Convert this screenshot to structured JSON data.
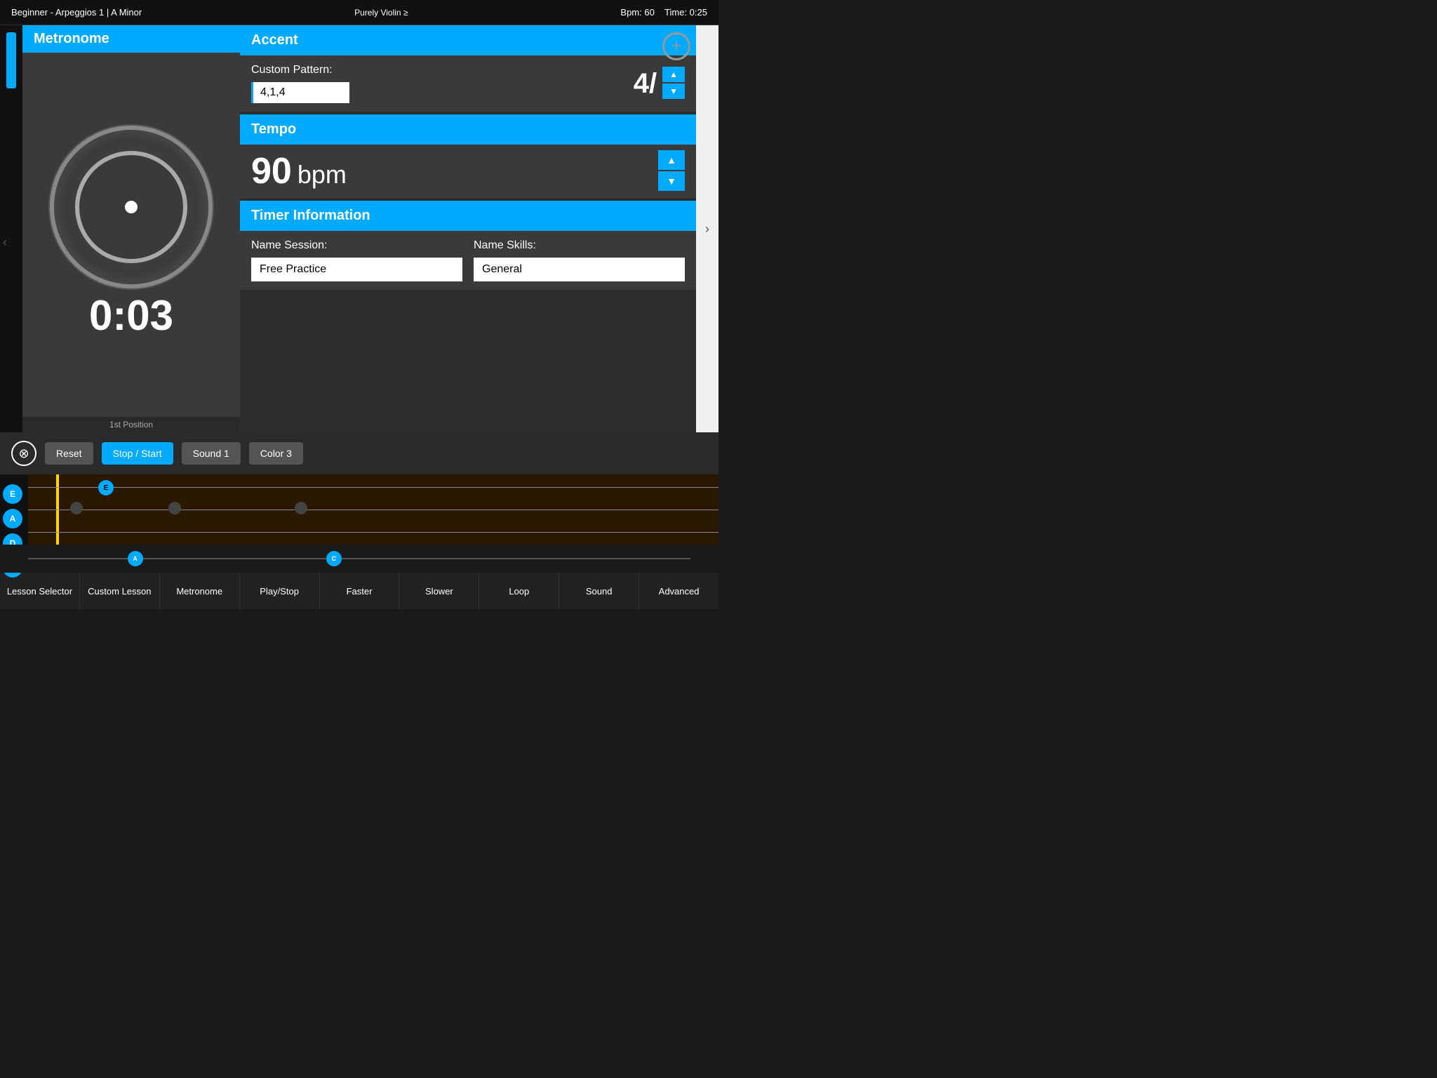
{
  "topBar": {
    "title": "Beginner - Arpeggios 1  |  A Minor",
    "center": "Purely Violin ≥",
    "bpm": "Bpm: 60",
    "time": "Time: 0:25"
  },
  "addButton": "+",
  "metronome": {
    "header": "Metronome",
    "time": "0:03",
    "positionLabel": "1st Position"
  },
  "accent": {
    "header": "Accent",
    "customPatternLabel": "Custom Pattern:",
    "patternValue": "4,1,4",
    "timeSig": "4/"
  },
  "tempo": {
    "header": "Tempo",
    "value": "90",
    "unit": "bpm"
  },
  "timerInfo": {
    "header": "Timer Information",
    "sessionLabel": "Name Session:",
    "skillsLabel": "Name Skills:",
    "sessionValue": "Free Practice",
    "skillsValue": "General"
  },
  "controlBar": {
    "closeLabel": "⊗",
    "resetLabel": "Reset",
    "stopStartLabel": "Stop / Start",
    "soundLabel": "Sound 1",
    "colorLabel": "Color 3"
  },
  "strings": [
    {
      "label": "E"
    },
    {
      "label": "A"
    },
    {
      "label": "D"
    },
    {
      "label": "G"
    }
  ],
  "sliderThumbs": [
    {
      "label": "A",
      "pos": "15%"
    },
    {
      "label": "C",
      "pos": "45%"
    }
  ],
  "bottomNav": {
    "items": [
      "Lesson Selector",
      "Custom Lesson",
      "Metronome",
      "Play/Stop",
      "Faster",
      "Slower",
      "Loop",
      "Sound",
      "Advanced"
    ]
  }
}
